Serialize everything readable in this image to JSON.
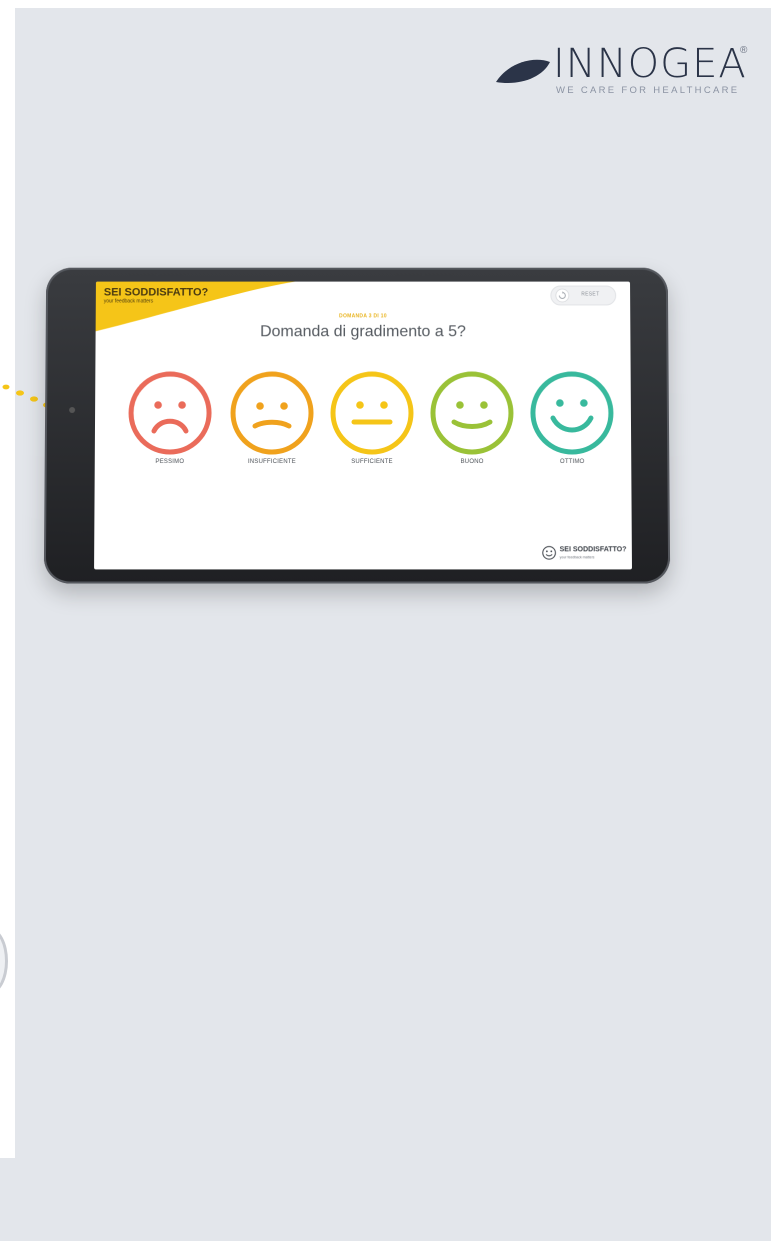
{
  "logo": {
    "name": "INNOGEA",
    "registered": "®",
    "tagline": "WE CARE FOR HEALTHCARE"
  },
  "app": {
    "brand_title": "SEI SODDISFATTO?",
    "brand_subtitle": "your feedback matters",
    "reset_label": "RESET",
    "question_counter": "DOMANDA 3 DI 10",
    "question": "Domanda di gradimento a 5?",
    "footer_title": "SEI SODDISFATTO?",
    "footer_subtitle": "your feedback matters"
  },
  "faces": [
    {
      "label": "PESSIMO",
      "color": "#ea6b5a",
      "mood": "very-sad"
    },
    {
      "label": "INSUFFICIENTE",
      "color": "#f0a21d",
      "mood": "sad"
    },
    {
      "label": "SUFFICIENTE",
      "color": "#f5c518",
      "mood": "neutral"
    },
    {
      "label": "BUONO",
      "color": "#9ac237",
      "mood": "happy"
    },
    {
      "label": "OTTIMO",
      "color": "#38b99d",
      "mood": "very-happy"
    }
  ],
  "colors": {
    "background": "#e3e6eb",
    "accent_yellow": "#f5c518",
    "logo_navy": "#2b3448"
  }
}
